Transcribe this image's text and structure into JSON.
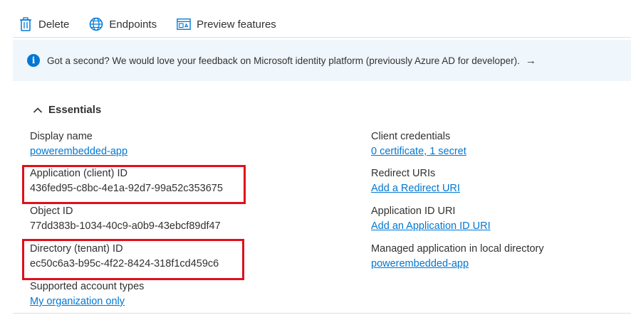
{
  "toolbar": {
    "delete_label": "Delete",
    "endpoints_label": "Endpoints",
    "preview_label": "Preview features"
  },
  "banner": {
    "text": "Got a second? We would love your feedback on Microsoft identity platform (previously Azure AD for developer).",
    "arrow": "→"
  },
  "essentials": {
    "title": "Essentials",
    "left": [
      {
        "label": "Display name",
        "value": "powerembedded-app",
        "link": true
      },
      {
        "label": "Application (client) ID",
        "value": "436fed95-c8bc-4e1a-92d7-99a52c353675",
        "link": false
      },
      {
        "label": "Object ID",
        "value": "77dd383b-1034-40c9-a0b9-43ebcf89df47",
        "link": false
      },
      {
        "label": "Directory (tenant) ID",
        "value": "ec50c6a3-b95c-4f22-8424-318f1cd459c6",
        "link": false
      },
      {
        "label": "Supported account types",
        "value": "My organization only",
        "link": true
      }
    ],
    "right": [
      {
        "label": "Client credentials",
        "value": "0 certificate, 1 secret",
        "link": true
      },
      {
        "label": "Redirect URIs",
        "value": "Add a Redirect URI",
        "link": true
      },
      {
        "label": "Application ID URI",
        "value": "Add an Application ID URI",
        "link": true
      },
      {
        "label": "Managed application in local directory",
        "value": "powerembedded-app",
        "link": true
      }
    ]
  },
  "colors": {
    "link": "#0078d4",
    "banner_bg": "#eff6fc",
    "highlight": "#e00f1b"
  }
}
